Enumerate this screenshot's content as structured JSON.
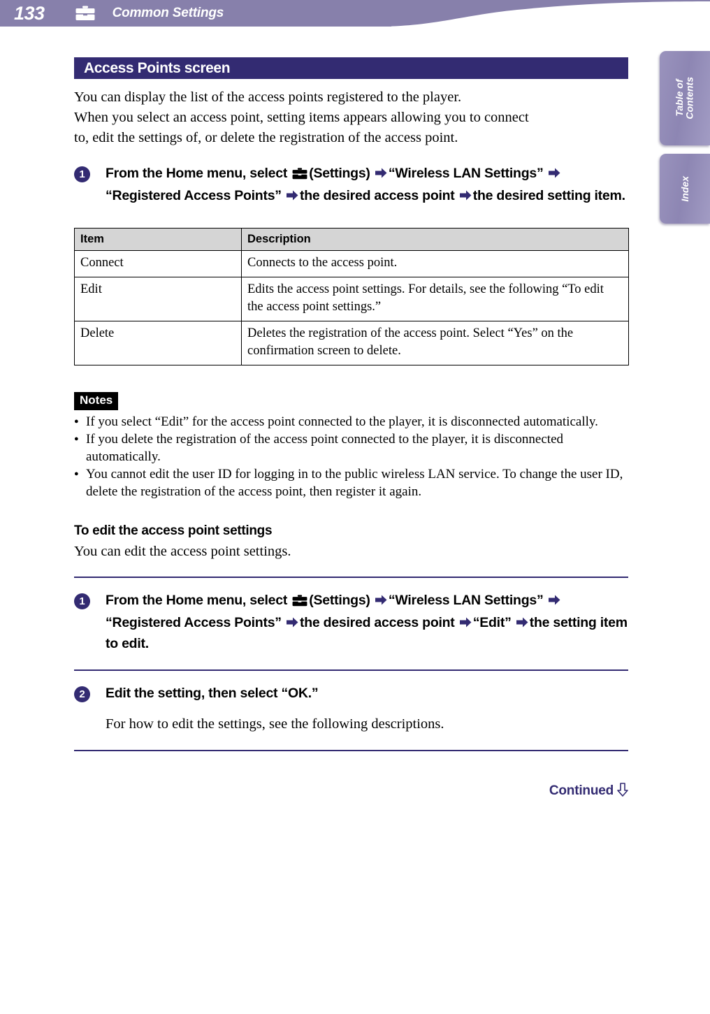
{
  "header": {
    "page_number": "133",
    "icon": "toolbox-settings-icon",
    "title": "Common Settings",
    "bar_color": "#8780ab"
  },
  "side_tabs": [
    {
      "name": "table-of-contents",
      "label": "Table of\nContents"
    },
    {
      "name": "index",
      "label": "Index"
    }
  ],
  "section": {
    "title": "Access Points screen",
    "title_bar_color": "#332b72"
  },
  "intro": {
    "line1": "You can display the list of the access points registered to the player.",
    "line2": "When you select an access point, setting items appears allowing you to connect",
    "line3": "to, edit the settings of, or delete the registration of the access point."
  },
  "step1": {
    "number": "1",
    "t1": "From the Home menu, select",
    "t2": "(Settings)",
    "t3": "“Wireless LAN Settings”",
    "t4": "“Registered Access Points”",
    "t5": "the desired access point",
    "t6": "the desired setting item."
  },
  "table": {
    "headers": [
      "Item",
      "Description"
    ],
    "rows": [
      [
        "Connect",
        "Connects to the access point."
      ],
      [
        "Edit",
        "Edits the access point settings. For details, see the following “To edit the access point settings.”"
      ],
      [
        "Delete",
        "Deletes the registration of the access point. Select “Yes” on the confirmation screen to delete."
      ]
    ]
  },
  "notes": {
    "label": "Notes",
    "items": [
      "If you select “Edit” for the access point connected to the player, it is disconnected automatically.",
      "If you delete the registration of the access point connected to the player, it is disconnected automatically.",
      "You cannot edit the user ID for logging in to the public wireless LAN service. To change the user ID, delete the registration of the access point, then register it again."
    ]
  },
  "subsection": {
    "heading": "To edit the access point settings",
    "paragraph": "You can edit the access point settings."
  },
  "step1b": {
    "number": "1",
    "t1": "From the Home menu, select",
    "t2": "(Settings)",
    "t3": "“Wireless LAN Settings”",
    "t4": "“Registered Access Points”",
    "t5": "the desired access point",
    "t6": "“Edit”",
    "t7": "the setting item to edit."
  },
  "step2": {
    "number": "2",
    "text": "Edit the setting, then select “OK.”",
    "sub": "For how to edit the settings, see the following descriptions."
  },
  "footer": {
    "continued_label": "Continued",
    "continued_icon": "down-arrow-icon",
    "color": "#332b72"
  }
}
